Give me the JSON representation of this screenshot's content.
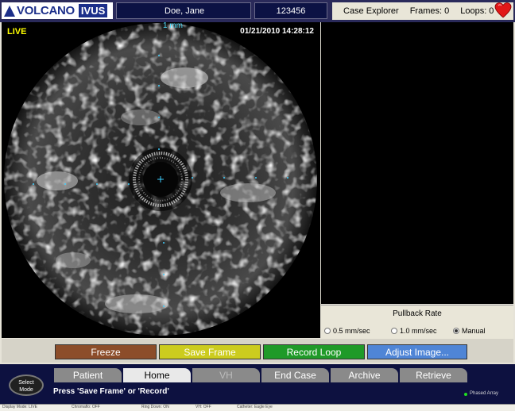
{
  "header": {
    "brand": "VOLCANO",
    "product": "IVUS",
    "patient_name": "Doe, Jane",
    "patient_id": "123456",
    "case_explorer": "Case Explorer",
    "frames": "Frames: 0",
    "loops": "Loops: 0"
  },
  "image": {
    "live": "LIVE",
    "scale": "1 mm",
    "timestamp": "01/21/2010 14:28:12"
  },
  "pullback": {
    "title": "Pullback Rate",
    "options": [
      "0.5 mm/sec",
      "1.0 mm/sec",
      "Manual"
    ],
    "selected": "Manual"
  },
  "actions": {
    "freeze": "Freeze",
    "save_frame": "Save Frame",
    "record_loop": "Record Loop",
    "adjust_image": "Adjust Image..."
  },
  "colors": {
    "freeze": "#8c4d2a",
    "save_frame": "#cccc1e",
    "record_loop": "#1f9a28",
    "adjust_image": "#4f85d6"
  },
  "nav": {
    "select_mode": [
      "Select",
      "Mode"
    ],
    "tabs": [
      "Patient",
      "Home",
      "VH",
      "End Case",
      "Archive",
      "Retrieve"
    ],
    "active_tab": "Home",
    "message": "Press 'Save Frame' or 'Record'",
    "phased_array": "Phased Array"
  },
  "statusbar": [
    "Display Mode: LIVE",
    "Chromaflo: OFF",
    "Ring Down: ON",
    "VH: OFF",
    "Catheter: Eagle Eye"
  ]
}
